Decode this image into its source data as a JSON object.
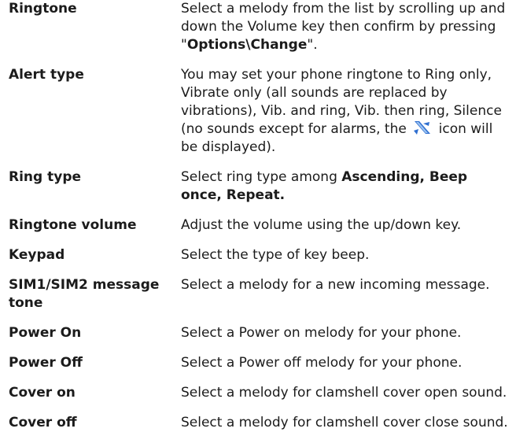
{
  "rows": [
    {
      "term": "Ringtone",
      "def_pre": "Select a melody from the list by scrolling up and down the Volume key then confirm by pressing \"",
      "def_bold": "Options\\Change",
      "def_post": "\"."
    },
    {
      "term": "Alert type",
      "def_pre": "You may set your phone ringtone to Ring only, Vibrate only (all sounds are replaced by vibrations), Vib. and ring, Vib. then ring, Silence (no sounds except for alarms, the",
      "icon": "silent-mode-icon",
      "def_post": "icon will be displayed)."
    },
    {
      "term": "Ring type",
      "def_pre": "Select ring type among ",
      "def_bold": "Ascending, Beep once, Repeat."
    },
    {
      "term": "Ringtone volume",
      "def": "Adjust the volume using the up/down key."
    },
    {
      "term": "Keypad",
      "def": "Select the type of key beep."
    },
    {
      "term": "SIM1/SIM2 message tone",
      "def": "Select a melody for a new incoming message."
    },
    {
      "term": "Power On",
      "def": "Select a Power on melody for your phone."
    },
    {
      "term": "Power Off",
      "def": "Select a Power off melody for your phone."
    },
    {
      "term": "Cover on",
      "def": "Select a melody for clamshell cover open sound."
    },
    {
      "term": "Cover off",
      "def": "Select a melody for clamshell cover close sound."
    }
  ],
  "colors": {
    "text": "#1b1b1b",
    "icon_blue": "#2f6fd0",
    "icon_light": "#9cc3f2"
  }
}
